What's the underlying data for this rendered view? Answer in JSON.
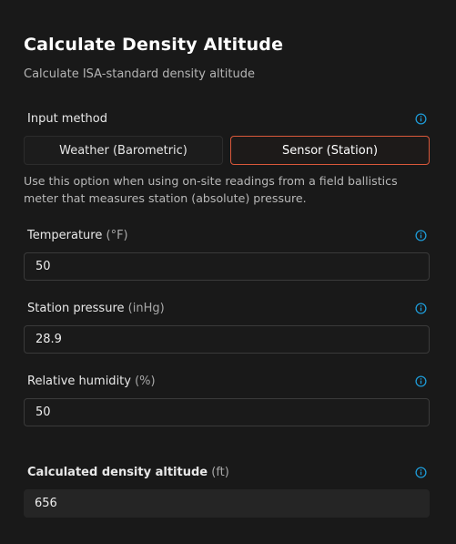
{
  "header": {
    "title": "Calculate Density Altitude",
    "subtitle": "Calculate ISA-standard density altitude"
  },
  "input_method": {
    "label": "Input method",
    "options": [
      "Weather (Barometric)",
      "Sensor (Station)"
    ],
    "selected": "Sensor (Station)",
    "help_text": "Use this option when using on-site readings from a field ballistics meter that measures station (absolute) pressure."
  },
  "fields": {
    "temperature": {
      "label": "Temperature",
      "unit": "(°F)",
      "value": "50"
    },
    "station_pressure": {
      "label": "Station pressure",
      "unit": "(inHg)",
      "value": "28.9"
    },
    "relative_humidity": {
      "label": "Relative humidity",
      "unit": "(%)",
      "value": "50"
    }
  },
  "result": {
    "label": "Calculated density altitude",
    "unit": "(ft)",
    "value": "656"
  },
  "colors": {
    "background": "#191919",
    "accent_border": "#d9583a",
    "info_icon": "#1e9bd7"
  },
  "icons": {
    "info": "info-circle-icon"
  }
}
